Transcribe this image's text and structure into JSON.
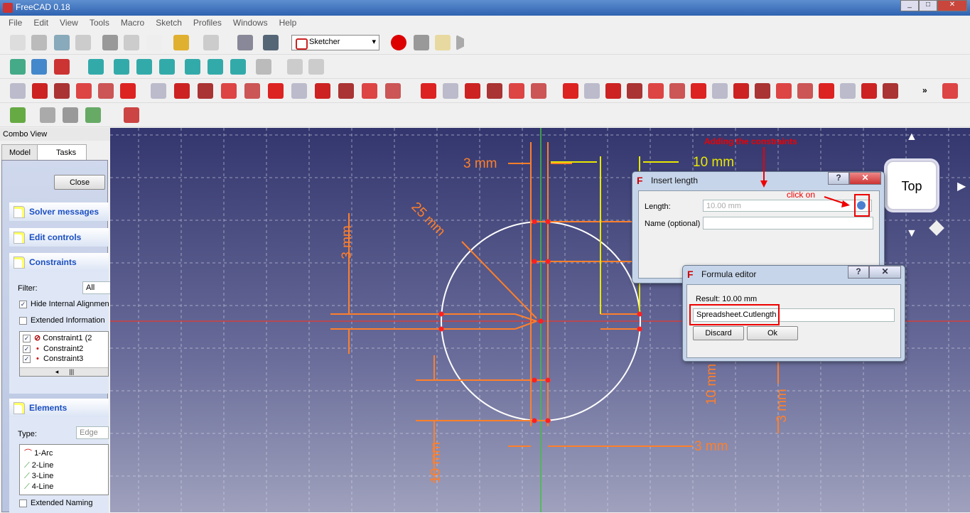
{
  "window": {
    "title": "FreeCAD 0.18",
    "controls": [
      "_",
      "□",
      "✕"
    ]
  },
  "menu": [
    "File",
    "Edit",
    "View",
    "Tools",
    "Macro",
    "Sketch",
    "Profiles",
    "Windows",
    "Help"
  ],
  "toolbar": {
    "workbench": "Sketcher",
    "overflow": "»"
  },
  "combo_view": {
    "title": "Combo View",
    "tabs": [
      "Model",
      "Tasks"
    ],
    "active_tab": "Tasks",
    "close_label": "Close",
    "sections": {
      "solver": "Solver messages",
      "edit": "Edit controls",
      "constraints": "Constraints",
      "elements": "Elements"
    },
    "filter_label": "Filter:",
    "filter_value": "All",
    "hide_internal": {
      "label": "Hide Internal Alignment",
      "checked": true
    },
    "extended_info": {
      "label": "Extended Information",
      "checked": false
    },
    "constraints": [
      {
        "name": "Constraint1 (2",
        "checked": true,
        "icon": "radius-icon"
      },
      {
        "name": "Constraint2",
        "checked": true,
        "icon": "point-icon"
      },
      {
        "name": "Constraint3",
        "checked": true,
        "icon": "point-icon"
      }
    ],
    "type_label": "Type:",
    "type_value": "Edge",
    "elements": [
      "1-Arc",
      "2-Line",
      "3-Line",
      "4-Line"
    ],
    "extended_naming": {
      "label": "Extended Naming",
      "checked": false
    }
  },
  "sketch": {
    "dims": {
      "d1": "3 mm",
      "d2": "10 mm",
      "d3": "25 mm",
      "d4": "3 mm",
      "d5": "10 mm",
      "d6": "3 mm",
      "d7": "10 mm",
      "d8": "3 mm"
    },
    "annotation_title": "Adding the constraints",
    "annotation_click": "click on",
    "navcube_face": "Top"
  },
  "insert_length": {
    "title": "Insert length",
    "length_label": "Length:",
    "length_value": "10.00 mm",
    "name_label": "Name (optional)",
    "name_value": ""
  },
  "formula_editor": {
    "title": "Formula editor",
    "result": "Result:  10.00 mm",
    "expression": "Spreadsheet.Cutlength",
    "discard": "Discard",
    "ok": "Ok"
  },
  "colors": {
    "dimension": "#ff7f2a",
    "selected_dimension": "#e8e800",
    "annotation": "#e00000",
    "axis_x": "#d04040",
    "axis_y": "#40c040"
  }
}
